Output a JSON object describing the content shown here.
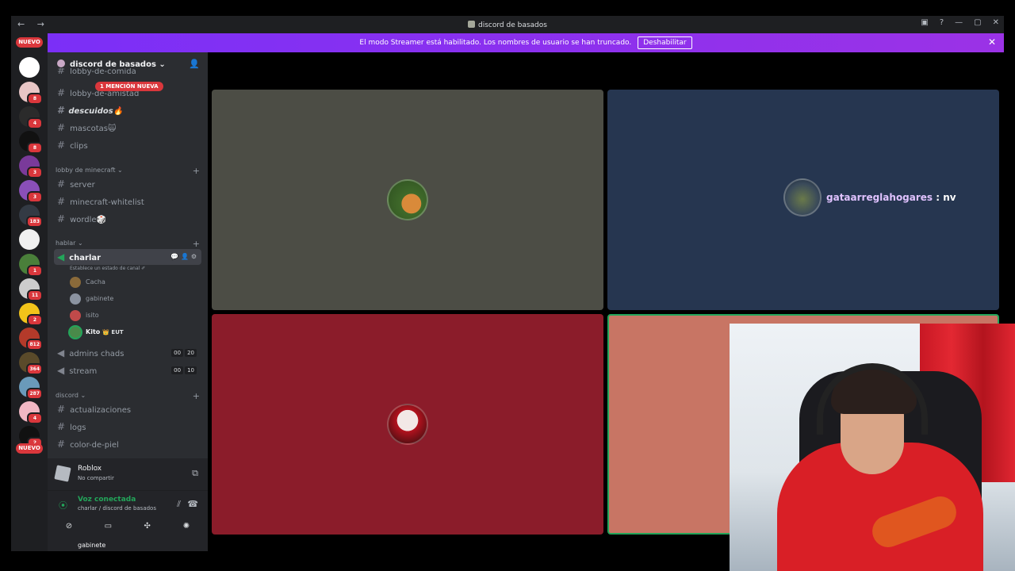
{
  "window": {
    "title": "discord de basados",
    "nav_arrows": "←  →",
    "controls": [
      "inbox-icon",
      "help-icon",
      "minimize",
      "maximize",
      "close"
    ]
  },
  "banner": {
    "text": "El modo Streamer está habilitado. Los nombres de usuario se han truncado.",
    "button": "Deshabilitar",
    "close": "✕"
  },
  "rail": {
    "nuevo_top": "NUEVO",
    "nuevo_bottom": "NUEVO",
    "servers": [
      {
        "badge": "",
        "color": "#ffffff"
      },
      {
        "badge": "8",
        "color": "#e8c6c6"
      },
      {
        "badge": "4",
        "color": "#2b2b2b"
      },
      {
        "badge": "8",
        "color": "#111111"
      },
      {
        "badge": "3",
        "color": "#7a3a9a"
      },
      {
        "badge": "3",
        "color": "#8a4fb8"
      },
      {
        "badge": "183",
        "color": "#333a44"
      },
      {
        "badge": "",
        "color": "#f0f0f0"
      },
      {
        "badge": "1",
        "color": "#4a7f3a"
      },
      {
        "badge": "11",
        "color": "#cccccc"
      },
      {
        "badge": "2",
        "color": "#f2c41a"
      },
      {
        "badge": "812",
        "color": "#b43a2a"
      },
      {
        "badge": "364",
        "color": "#5a4a2a"
      },
      {
        "badge": "287",
        "color": "#6a9aba"
      },
      {
        "badge": "4",
        "color": "#f1b8c4"
      },
      {
        "badge": "2",
        "color": "#111111"
      }
    ]
  },
  "sidebar": {
    "server_name": "discord de basados",
    "mention": "1 MENCIÓN NUEVA",
    "channels_top": [
      {
        "label": "lobby-de-comida",
        "top": 1
      },
      {
        "label": "lobby-de-amistad"
      },
      {
        "label": "descuidos🔥"
      },
      {
        "label": "mascotas🙀"
      },
      {
        "label": "clips"
      }
    ],
    "cat_minecraft": "lobby de minecraft",
    "minecraft_channels": [
      "server",
      "minecraft-whitelist",
      "wordle🎲"
    ],
    "cat_hablar": "hablar",
    "voice_active": "charlar",
    "voice_status": "Establece un estado de canal ✐",
    "voice_users": [
      {
        "name": "Cacha",
        "tag": ""
      },
      {
        "name": "gabinete",
        "tag": ""
      },
      {
        "name": "isito",
        "tag": ""
      },
      {
        "name": "Kito",
        "tag": "EUT"
      }
    ],
    "voice_channels": [
      {
        "label": "admins chads",
        "c1": "00",
        "c2": "20"
      },
      {
        "label": "stream",
        "c1": "00",
        "c2": "10"
      }
    ],
    "cat_discord": "discord",
    "discord_channels": [
      "actualizaciones",
      "logs",
      "color-de-piel"
    ]
  },
  "activity": {
    "name": "Roblox",
    "sub": "No compartir"
  },
  "voice": {
    "state": "Voz conectada",
    "where": "charlar / discord de basados"
  },
  "userbar": {
    "name": "gabinete"
  },
  "stage": {
    "tiles": [
      {
        "bg": "#4c4d45"
      },
      {
        "bg": "#263650"
      },
      {
        "bg": "#8b1c2a"
      },
      {
        "bg": "#c87564"
      }
    ],
    "speaking_name": "gataarreglahogares",
    "speaking_suffix": " : nv"
  },
  "colors": {
    "accent": "#8a2be2",
    "danger": "#da373c",
    "online": "#23a55a"
  }
}
